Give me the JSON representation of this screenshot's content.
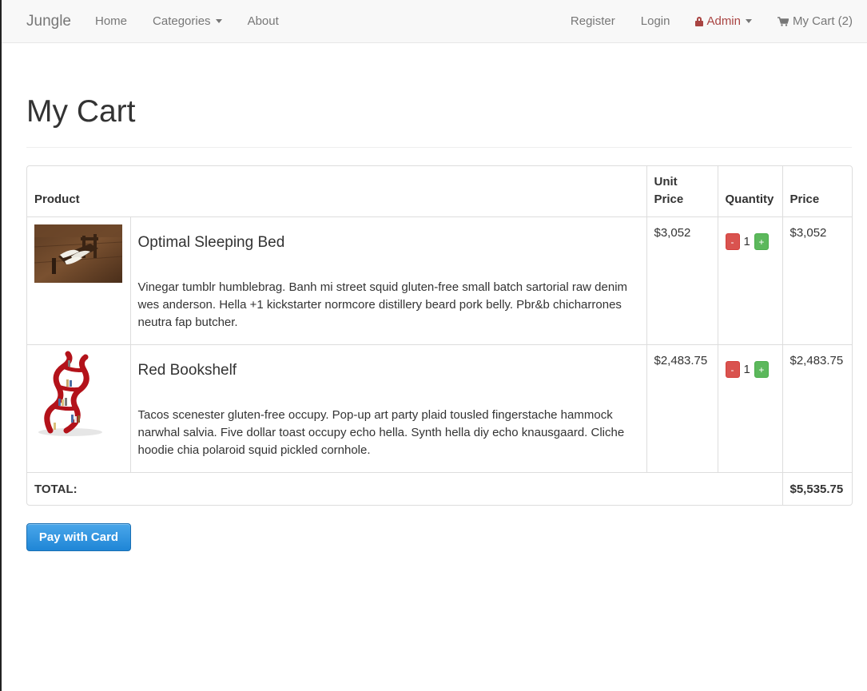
{
  "nav": {
    "brand": "Jungle",
    "left": [
      {
        "label": "Home"
      },
      {
        "label": "Categories"
      },
      {
        "label": "About"
      }
    ],
    "register": "Register",
    "login": "Login",
    "admin": "Admin",
    "cart": "My Cart (2)",
    "admin_color": "#a94442"
  },
  "page": {
    "title": "My Cart"
  },
  "table": {
    "headers": {
      "product": "Product",
      "unit_price": "Unit Price",
      "quantity": "Quantity",
      "price": "Price"
    },
    "items": [
      {
        "name": "Optimal Sleeping Bed",
        "description": "Vinegar tumblr humblebrag. Banh mi street squid gluten-free small batch sartorial raw denim wes anderson. Hella +1 kickstarter normcore distillery beard pork belly. Pbr&b chicharrones neutra fap butcher.",
        "unit_price": "$3,052",
        "quantity": "1",
        "price": "$3,052",
        "image": "bed-image"
      },
      {
        "name": "Red Bookshelf",
        "description": "Tacos scenester gluten-free occupy. Pop-up art party plaid tousled fingerstache hammock narwhal salvia. Five dollar toast occupy echo hella. Synth hella diy echo knausgaard. Cliche hoodie chia polaroid squid pickled cornhole.",
        "unit_price": "$2,483.75",
        "quantity": "1",
        "price": "$2,483.75",
        "image": "bookshelf-image"
      }
    ],
    "minus": "-",
    "plus": "+",
    "total_label": "TOTAL:",
    "total_value": "$5,535.75"
  },
  "pay_button": "Pay with Card",
  "colors": {
    "minus": "#d9534f",
    "plus": "#5cb85c",
    "pay": "#1f86d6"
  }
}
